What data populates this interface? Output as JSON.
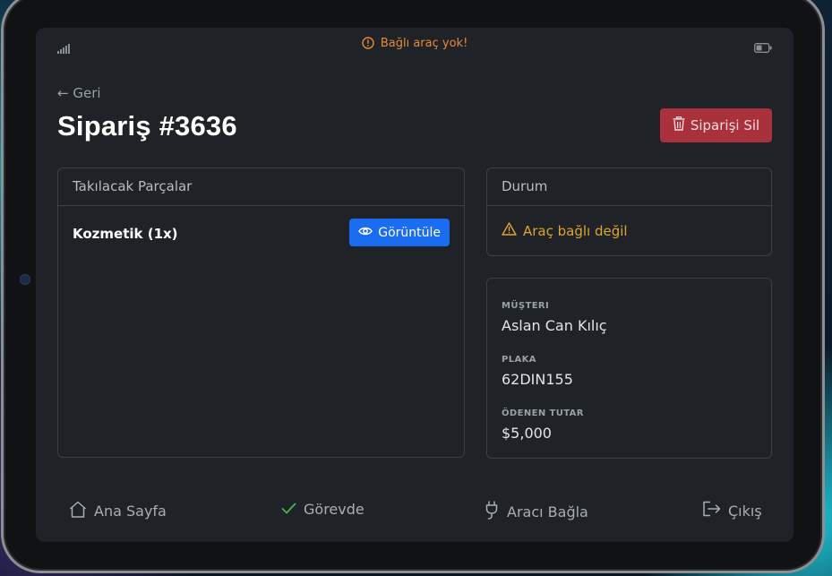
{
  "status_bar": {
    "message": "Bağlı araç yok!",
    "icons": [
      "signal-icon",
      "warning-circle-icon",
      "battery-icon"
    ],
    "warning_color": "#e8893a"
  },
  "header": {
    "back_label": "← Geri",
    "title": "Sipariş #3636",
    "delete_label": "Siparişi Sil",
    "delete_color": "#a8313b"
  },
  "parts_card": {
    "title": "Takılacak Parçalar",
    "items": [
      {
        "name": "Kozmetik (1x)",
        "action_label": "Görüntüle"
      }
    ],
    "action_color": "#1a6df0"
  },
  "status_card": {
    "title": "Durum",
    "message": "Araç bağlı değil",
    "message_color": "#e0a52c"
  },
  "info_card": {
    "fields": [
      {
        "label": "MÜŞTERI",
        "value": "Aslan Can Kılıç"
      },
      {
        "label": "PLAKA",
        "value": "62DIN155"
      },
      {
        "label": "ÖDENEN TUTAR",
        "value": "$5,000"
      }
    ]
  },
  "nav": {
    "items": [
      {
        "label": "Ana Sayfa",
        "icon": "home-icon"
      },
      {
        "label": "Görevde",
        "icon": "check-icon"
      },
      {
        "label": "Aracı Bağla",
        "icon": "plug-icon"
      },
      {
        "label": "Çıkış",
        "icon": "logout-icon"
      }
    ],
    "active_check_color": "#3fb950"
  }
}
